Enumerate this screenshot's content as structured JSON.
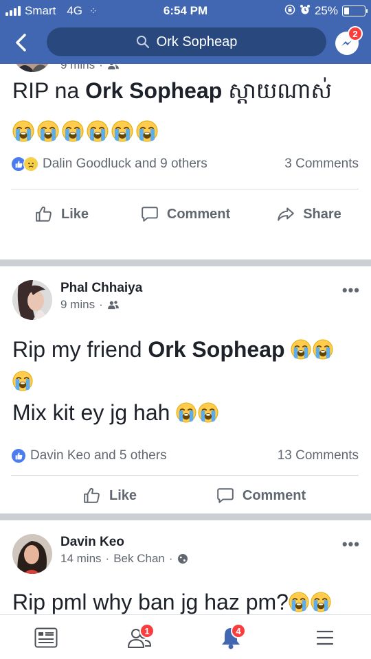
{
  "status_bar": {
    "carrier": "Smart",
    "network": "4G",
    "time": "6:54 PM",
    "battery": "25%",
    "battery_level": 0.25
  },
  "nav": {
    "search_text": "Ork Sopheap",
    "messenger_badge": "2"
  },
  "posts": [
    {
      "time": "9 mins",
      "privacy": "friends-icon",
      "text_prefix": "RIP na ",
      "text_bold": "Ork Sopheap",
      "text_suffix": " ស្តាយណាស់",
      "emoji_count": 6,
      "reactions_text": "Dalin Goodluck and 9 others",
      "reaction_types": [
        "like",
        "sad"
      ],
      "comments": "3 Comments",
      "actions": {
        "like": "Like",
        "comment": "Comment",
        "share": "Share"
      }
    },
    {
      "author": "Phal Chhaiya",
      "time": "9 mins",
      "privacy": "friends-icon",
      "line1_prefix": "Rip my friend ",
      "line1_bold": "Ork Sopheap",
      "line2": "Mix kit ey jg hah",
      "reactions_text": "Davin Keo and 5 others",
      "reaction_types": [
        "like"
      ],
      "comments": "13 Comments",
      "actions": {
        "like": "Like",
        "comment": "Comment"
      }
    },
    {
      "author": "Davin Keo",
      "time": "14 mins",
      "location": "Bek Chan",
      "privacy": "globe-icon",
      "text": "Rip pml why ban jg haz pm?"
    }
  ],
  "bottom_nav": {
    "tabs": [
      "news-feed-icon",
      "friend-requests-icon",
      "notifications-icon",
      "menu-icon"
    ],
    "friend_requests_badge": "1",
    "notifications_badge": "4"
  },
  "colors": {
    "brand_blue": "#4267b2",
    "search_bg": "#29487d",
    "badge_red": "#fa3e3e",
    "muted_text": "#616770",
    "divider": "#cccfd4"
  }
}
